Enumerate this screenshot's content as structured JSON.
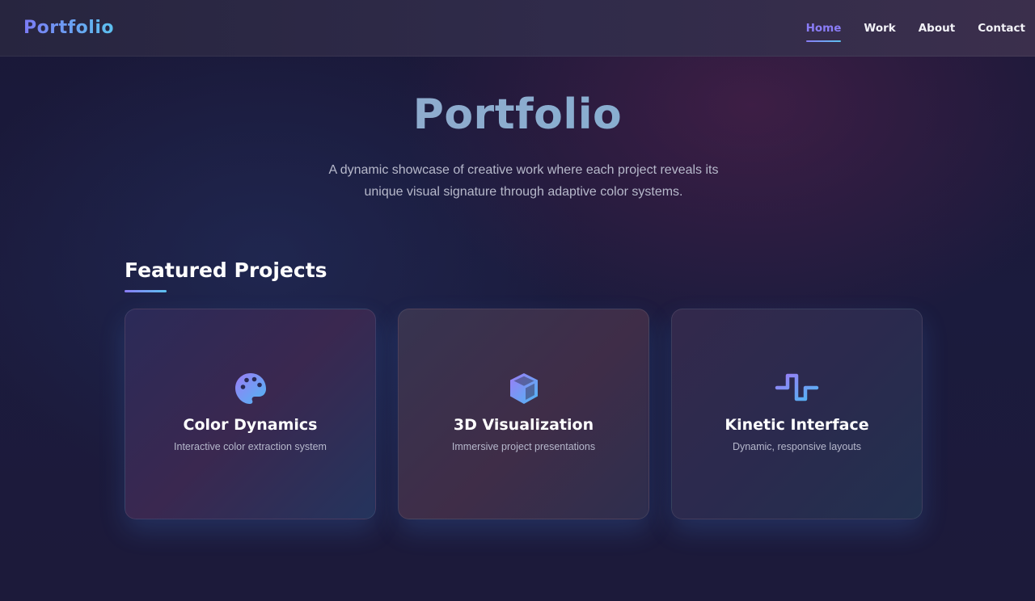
{
  "header": {
    "logo": "Portfolio",
    "nav": [
      {
        "label": "Home",
        "active": true
      },
      {
        "label": "Work",
        "active": false
      },
      {
        "label": "About",
        "active": false
      },
      {
        "label": "Contact",
        "active": false
      }
    ]
  },
  "hero": {
    "title": "Portfolio",
    "subtitle_line1": "A dynamic showcase of creative work where each project reveals its",
    "subtitle_line2": "unique visual signature through adaptive color systems."
  },
  "featured": {
    "title": "Featured Projects",
    "cards": [
      {
        "icon": "palette-icon",
        "title": "Color Dynamics",
        "description": "Interactive color extraction system"
      },
      {
        "icon": "cube-icon",
        "title": "3D Visualization",
        "description": "Immersive project presentations"
      },
      {
        "icon": "wave-icon",
        "title": "Kinetic Interface",
        "description": "Dynamic, responsive layouts"
      }
    ]
  },
  "colors": {
    "accent_purple": "#8a7cf6",
    "accent_blue": "#5cc2f0",
    "background": "#1b1b3d"
  }
}
